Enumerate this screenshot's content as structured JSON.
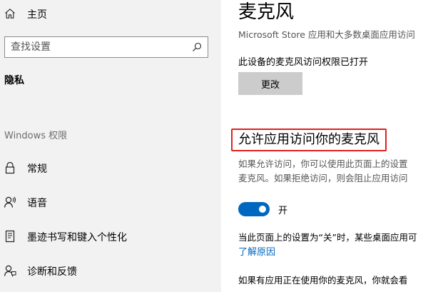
{
  "sidebar": {
    "home": {
      "label": "主页",
      "icon": "home-icon"
    },
    "search": {
      "placeholder": "查找设置",
      "icon": "search-icon"
    },
    "privacy_header": "隐私",
    "section_label": "Windows 权限",
    "items": [
      {
        "label": "常规",
        "icon": "lock-icon"
      },
      {
        "label": "语音",
        "icon": "speech-icon"
      },
      {
        "label": "墨迹书写和键入个性化",
        "icon": "inking-typing-icon"
      },
      {
        "label": "诊断和反馈",
        "icon": "diagnostics-feedback-icon"
      }
    ]
  },
  "main": {
    "title": "麦克风",
    "subtitle": "Microsoft Store 应用和大多数桌面应用访问",
    "device_status": "此设备的麦克风访问权限已打开",
    "change_button": "更改",
    "allow_heading": "允许应用访问你的麦克风",
    "description_lines": [
      "如果允许访问，你可以使用此页面上的设置",
      "麦克风。如果拒绝访问，则会阻止应用访问"
    ],
    "toggle": {
      "state": "on",
      "label": "开"
    },
    "note": "当此页面上的设置为“关”时，某些桌面应用可",
    "learn_more": "了解原因",
    "bottom_text": "如果有应用正在使用你的麦克风，你就会看"
  },
  "colors": {
    "accent": "#0067c0",
    "highlight_border": "#e02020",
    "sidebar_bg": "#f2f2f2",
    "button_bg": "#cccccc"
  }
}
